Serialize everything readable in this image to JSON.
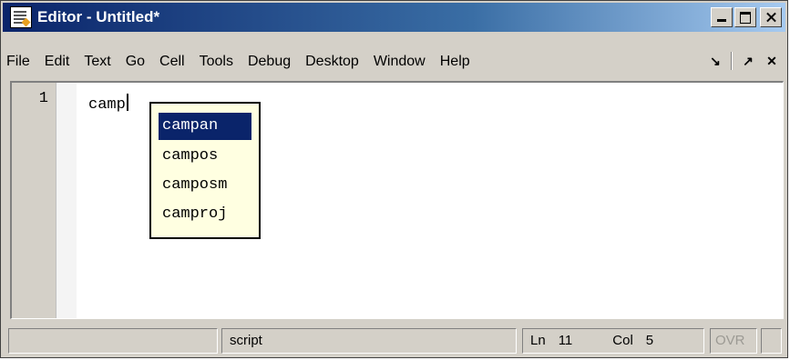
{
  "window": {
    "title": "Editor - Untitled*"
  },
  "menubar": {
    "items": [
      "File",
      "Edit",
      "Text",
      "Go",
      "Cell",
      "Tools",
      "Debug",
      "Desktop",
      "Window",
      "Help"
    ]
  },
  "editor": {
    "line_number": "1",
    "code_text": "camp"
  },
  "autocomplete": {
    "items": [
      "campan",
      "campos",
      "camposm",
      "camproj"
    ],
    "selected": "campan"
  },
  "statusbar": {
    "mode": "script",
    "ln_label": "Ln",
    "ln_value": "11",
    "col_label": "Col",
    "col_value": "5",
    "ovr": "OVR"
  },
  "colors": {
    "title_bar": "#0a246a",
    "chrome": "#d4d0c8",
    "popup_bg": "#ffffe1",
    "selection": "#0a246a"
  }
}
